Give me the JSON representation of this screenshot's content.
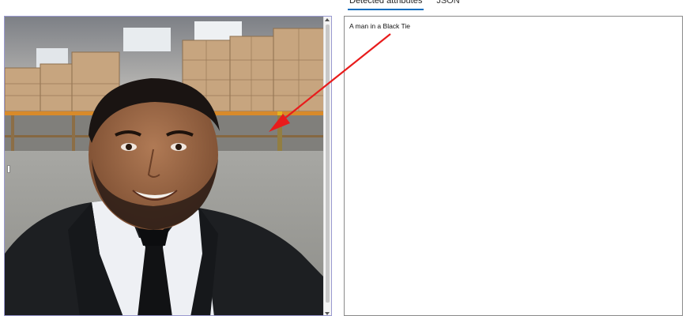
{
  "tabs": [
    {
      "label": "Detected attributes",
      "active": true
    },
    {
      "label": "JSON",
      "active": false
    }
  ],
  "result": {
    "text": "A man in a Black Tie"
  },
  "colors": {
    "annotation_arrow": "#e81c1c",
    "tab_underline": "#0f6cbd"
  },
  "image": {
    "description_icon": "photo-man-in-warehouse"
  }
}
